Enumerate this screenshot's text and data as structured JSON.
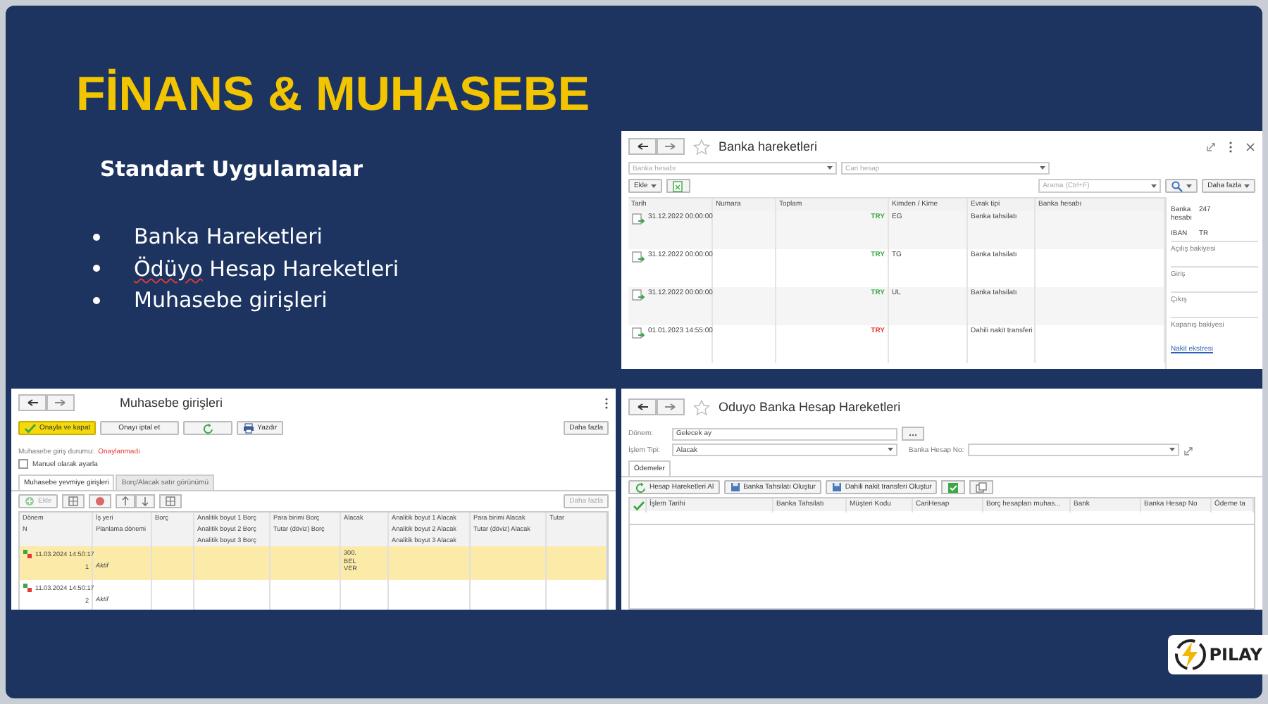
{
  "slide": {
    "title": "FİNANS & MUHASEBE",
    "subtitle": "Standart Uygulamalar",
    "bullets": [
      {
        "parts": [
          {
            "text": "Banka Hareketleri",
            "spelling_error": false
          }
        ]
      },
      {
        "parts": [
          {
            "text": "Ödüyo",
            "spelling_error": true
          },
          {
            "text": " Hesap Hareketleri",
            "spelling_error": false
          }
        ]
      },
      {
        "parts": [
          {
            "text": "Muhasebe girişleri",
            "spelling_error": false
          }
        ]
      }
    ]
  },
  "bank_window": {
    "title": "Banka hareketleri",
    "filters": [
      {
        "placeholder": "Banka hesabı"
      },
      {
        "placeholder": "Cari hesap"
      }
    ],
    "add_button": "Ekle",
    "search": {
      "placeholder": "Arama (Ctrl+F)"
    },
    "more_button": "Daha fazla",
    "columns": [
      "Tarih",
      "Numara",
      "Toplam",
      "Kimden / Kime",
      "Evrak tipi",
      "Banka hesabı"
    ],
    "rows": [
      {
        "date": "31.12.2022 00:00:00",
        "currency": "TRY",
        "color": "#3aa845",
        "party": "EG",
        "type": "Banka tahsilatı"
      },
      {
        "date": "31.12.2022 00:00:00",
        "currency": "TRY",
        "color": "#3aa845",
        "party": "TG",
        "type": "Banka tahsilatı"
      },
      {
        "date": "31.12.2022 00:00:00",
        "currency": "TRY",
        "color": "#3aa845",
        "party": "UL",
        "type": "Banka tahsilatı"
      },
      {
        "date": "01.01.2023 14:55:00",
        "currency": "TRY",
        "color": "#e53935",
        "party": "",
        "type": "Dahili nakit transferi"
      }
    ],
    "side_panel": {
      "account_label": "Banka hesabı",
      "account_value": "247",
      "iban_label": "IBAN",
      "iban_value": "TR",
      "sections": [
        "Açılış bakiyesi",
        "Giriş",
        "Çıkış",
        "Kapanış bakiyesi"
      ],
      "link": "Nakit ekstresi"
    }
  },
  "accounting_window": {
    "title": "Muhasebe girişleri",
    "buttons": [
      {
        "kind": "primary",
        "label": "Onayla ve kapat"
      },
      {
        "kind": "plain",
        "label": "Onayı iptal et"
      },
      {
        "kind": "refresh"
      },
      {
        "kind": "print",
        "label": "Yazdır"
      }
    ],
    "more_button": "Daha fazla",
    "status_label": "Muhasebe giriş durumu:",
    "status_value": "Onaylanmadı",
    "manual_checkbox": {
      "label": "Manuel olarak ayarla",
      "checked": false
    },
    "tabs": [
      {
        "label": "Muhasebe yevmiye girişleri",
        "selected": true
      },
      {
        "label": "Borç/Alacak satır görünümü",
        "selected": false
      }
    ],
    "add_button": {
      "label": "Ekle",
      "disabled": true
    },
    "table_more_button": {
      "label": "Daha fazla",
      "disabled": true
    },
    "columns": [
      [
        "Dönem",
        "N"
      ],
      [
        "İş yeri",
        "Planlama dönemi"
      ],
      [
        "Borç"
      ],
      [
        "Analitik boyut 1 Borç",
        "Analitik boyut 2 Borç",
        "Analitik boyut 3 Borç"
      ],
      [
        "Para birimi Borç",
        "Tutar (döviz) Borç"
      ],
      [
        "Alacak"
      ],
      [
        "Analitik boyut 1 Alacak",
        "Analitik boyut 2 Alacak",
        "Analitik boyut 3 Alacak"
      ],
      [
        "Para birimi Alacak",
        "Tutar (döviz) Alacak"
      ],
      [
        "Tutar"
      ]
    ],
    "rows": [
      {
        "date": "11.03.2024 14:50:17",
        "number": "1",
        "state": "Aktif",
        "credit": [
          "300.",
          "BEL",
          "VER"
        ],
        "selected": true
      },
      {
        "date": "11.03.2024 14:50:17",
        "number": "2",
        "state": "Aktif",
        "credit": [],
        "selected": false
      }
    ]
  },
  "oduyo_window": {
    "title": "Oduyo Banka Hesap Hareketleri",
    "period": {
      "label": "Dönem:",
      "value": "Gelecek ay"
    },
    "operation": {
      "label": "İşlem Tipi:",
      "value": "Alacak"
    },
    "account": {
      "label": "Banka Hesap No:"
    },
    "tabs": [
      {
        "label": "Ödemeler",
        "selected": true
      }
    ],
    "buttons": [
      {
        "kind": "refresh",
        "label": "Hesap Hareketleri Al"
      },
      {
        "kind": "save",
        "label": "Banka Tahsilatı Oluştur"
      },
      {
        "kind": "save",
        "label": "Dahili nakit transferi Oluştur"
      },
      {
        "kind": "check-all"
      },
      {
        "kind": "copy"
      }
    ],
    "columns": [
      "İşlem Tarihi",
      "Banka Tahsilatı",
      "Müşteri Kodu",
      "CariHesap",
      "Borç hesapları muhas...",
      "Bank",
      "Banka Hesap No",
      "Ödeme ta"
    ]
  },
  "logo": {
    "text": "PILAY"
  }
}
